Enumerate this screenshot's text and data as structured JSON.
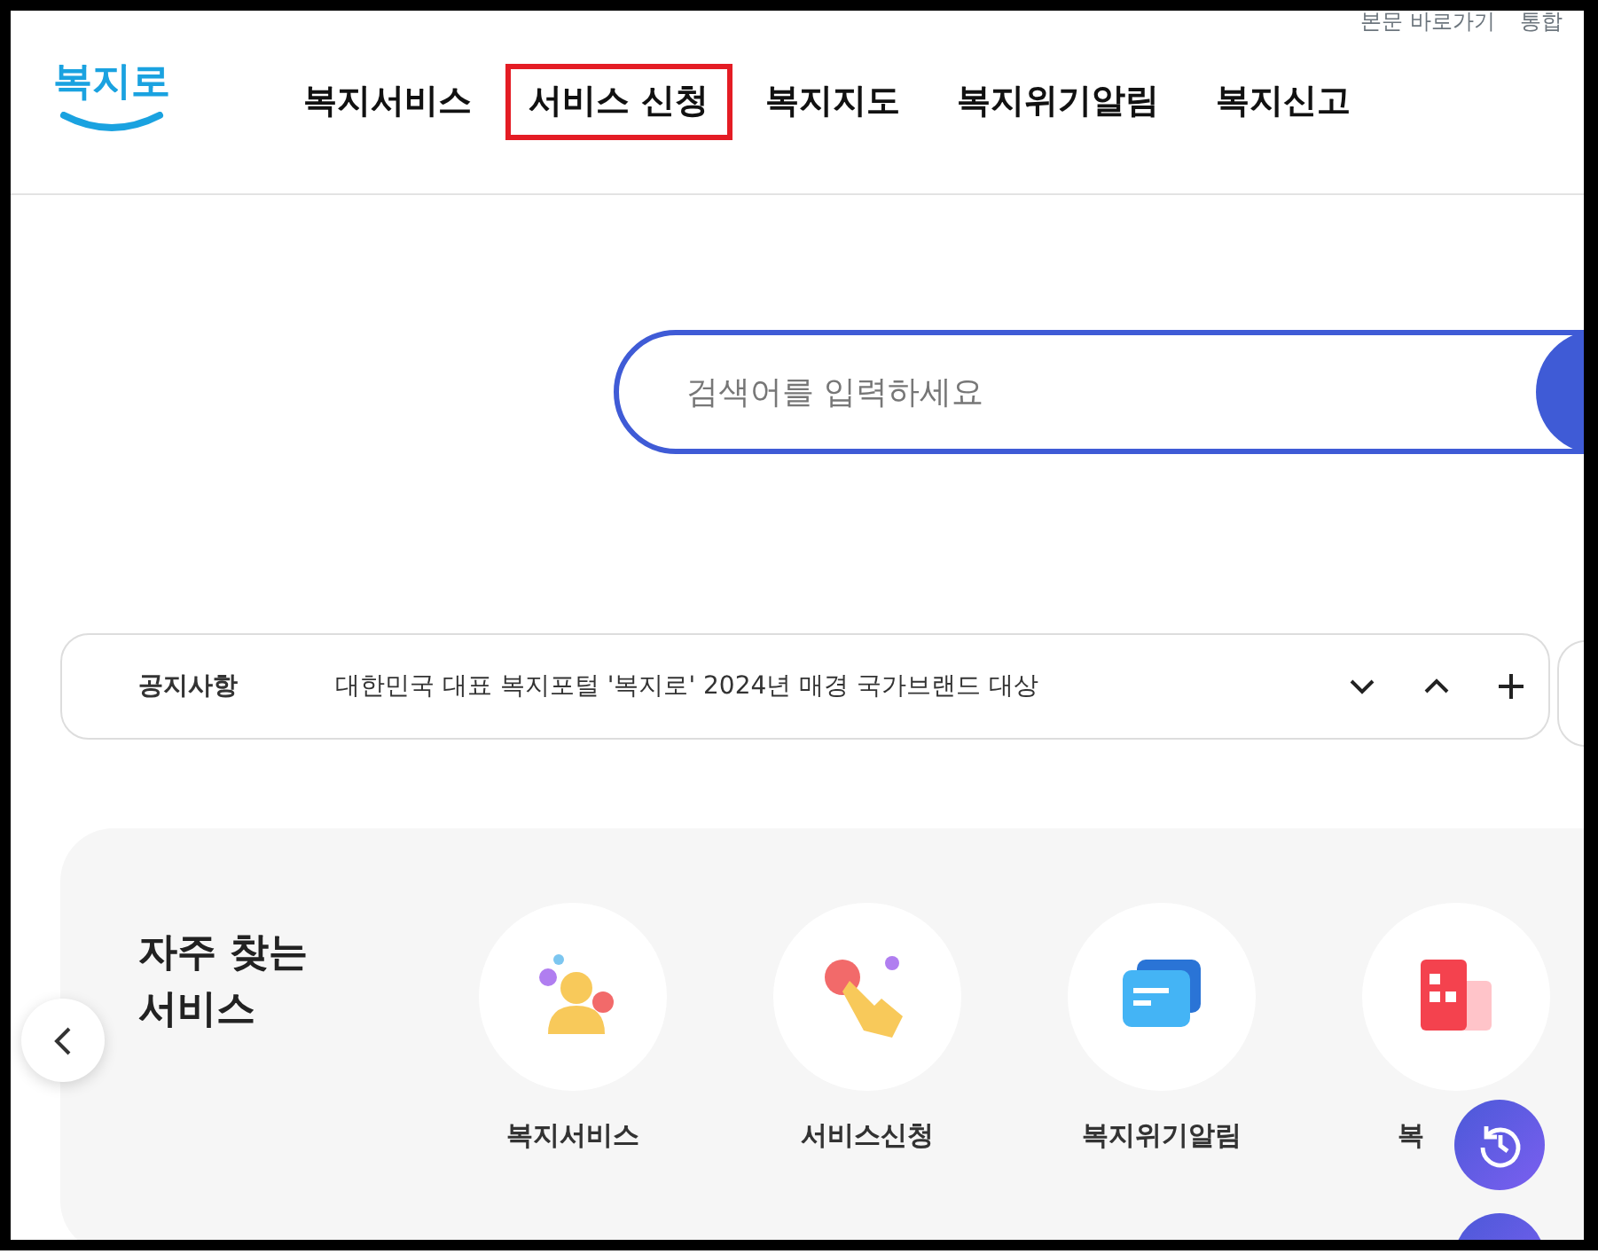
{
  "utility_links": [
    "본문 바로가기",
    "통합"
  ],
  "logo": {
    "text": "복지로"
  },
  "nav": [
    {
      "label": "복지서비스",
      "selected": false
    },
    {
      "label": "서비스 신청",
      "selected": true
    },
    {
      "label": "복지지도",
      "selected": false
    },
    {
      "label": "복지위기알림",
      "selected": false
    },
    {
      "label": "복지신고",
      "selected": false
    }
  ],
  "search": {
    "placeholder": "검색어를 입력하세요"
  },
  "notice": {
    "label": "공지사항",
    "text": "대한민국 대표 복지포털 '복지로' 2024년 매경 국가브랜드 대상"
  },
  "frequent_services": {
    "title": "자주 찾는\n서비스",
    "items": [
      {
        "label": "복지서비스",
        "kind": "person"
      },
      {
        "label": "서비스신청",
        "kind": "hand"
      },
      {
        "label": "복지위기알림",
        "kind": "message"
      },
      {
        "label": "복",
        "kind": "building"
      }
    ]
  }
}
